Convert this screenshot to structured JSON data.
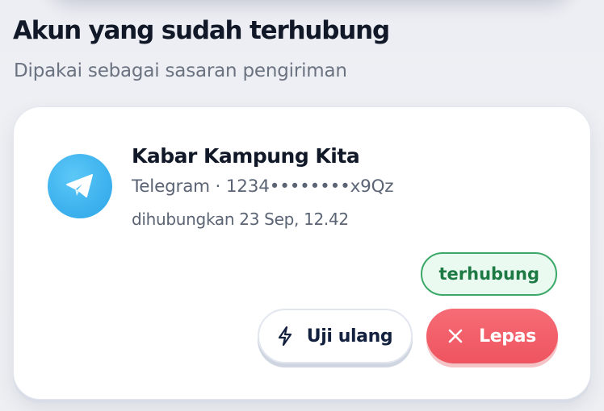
{
  "section": {
    "title": "Akun yang sudah terhubung",
    "subtitle": "Dipakai sebagai sasaran pengiriman"
  },
  "account": {
    "icon": "telegram-paper-plane-icon",
    "name": "Kabar Kampung Kita",
    "meta": "Telegram · 1234••••••••x9Qz",
    "connected_at": "dihubungkan 23 Sep, 12.42",
    "status": "terhubung"
  },
  "actions": {
    "retry_label": "Uji ulang",
    "retry_icon": "lightning-bolt-icon",
    "remove_label": "Lepas",
    "remove_icon": "close-x-icon"
  },
  "colors": {
    "telegram_blue": "#3eb2ee",
    "status_green": "#3aa867",
    "danger_red": "#ee545f"
  }
}
